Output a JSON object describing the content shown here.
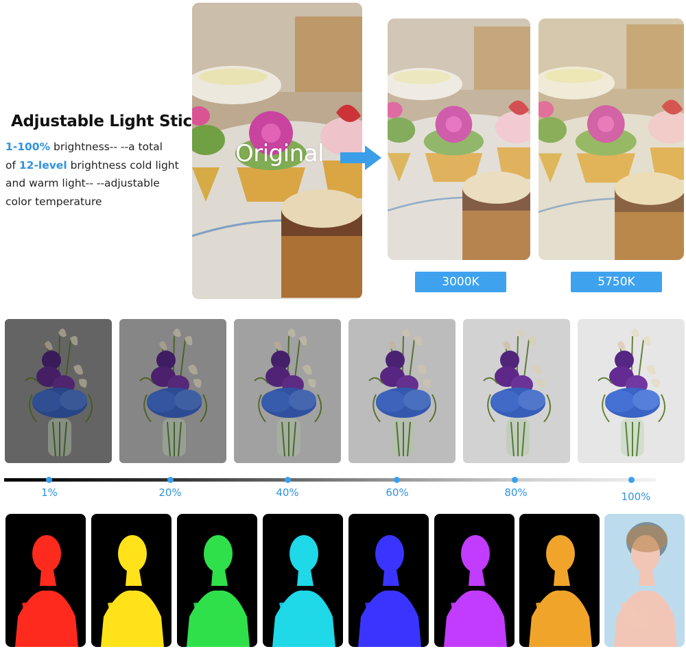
{
  "heading": {
    "title": "Adjustable Light Stick",
    "line1_highlight": "1-100%",
    "line1_rest": " brightness-- --a total",
    "line2_prefix": "of ",
    "line2_highlight": "12-level",
    "line2_rest": " brightness cold light",
    "line3": "and warm light-- --adjustable",
    "line4": "color temperature"
  },
  "comparison": {
    "original_label": "Original",
    "warm_label": "3000K",
    "cold_label": "5750K"
  },
  "brightness": {
    "levels": [
      "1%",
      "20%",
      "40%",
      "60%",
      "80%",
      "100%"
    ],
    "level_values": [
      1,
      20,
      40,
      60,
      80,
      100
    ]
  },
  "colors": {
    "accent": "#3ea2ee",
    "portrait_tints": [
      "#ff2a1e",
      "#ffe21a",
      "#2fe04a",
      "#1fd8e8",
      "#3a34ff",
      "#c23cff",
      "#f0a52a",
      "#ffffff"
    ],
    "card_backgrounds": [
      "#9a9a9a",
      "#bdbdbd",
      "#d2d2d2",
      "#e2e2e2",
      "#ececec",
      "#f3f3f3"
    ]
  }
}
